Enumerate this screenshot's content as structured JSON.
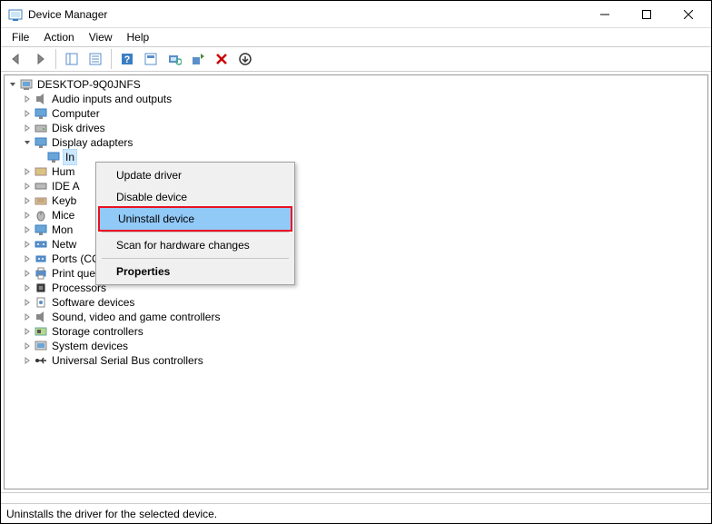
{
  "window": {
    "title": "Device Manager"
  },
  "menubar": {
    "file": "File",
    "action": "Action",
    "view": "View",
    "help": "Help"
  },
  "tree": {
    "root": "DESKTOP-9Q0JNFS",
    "audio": "Audio inputs and outputs",
    "computer": "Computer",
    "disk": "Disk drives",
    "display": "Display adapters",
    "display_child": "In",
    "hid": "Hum",
    "ide": "IDE A",
    "keyboards": "Keyb",
    "mice": "Mice",
    "monitors": "Mon",
    "network": "Netw",
    "ports": "Ports (COM & LPT)",
    "printq": "Print queues",
    "processors": "Processors",
    "software": "Software devices",
    "sound": "Sound, video and game controllers",
    "storage": "Storage controllers",
    "system": "System devices",
    "usb": "Universal Serial Bus controllers"
  },
  "context_menu": {
    "update": "Update driver",
    "disable": "Disable device",
    "uninstall": "Uninstall device",
    "scan": "Scan for hardware changes",
    "properties": "Properties"
  },
  "statusbar": {
    "text": "Uninstalls the driver for the selected device."
  }
}
